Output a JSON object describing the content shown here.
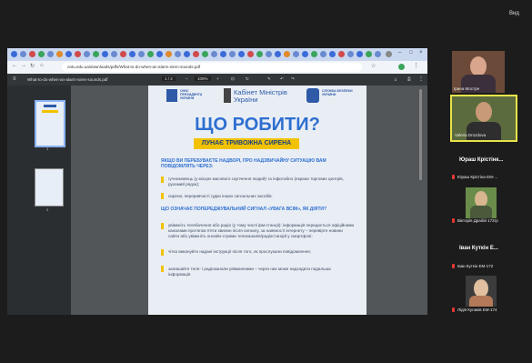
{
  "top_right_label": "Вид",
  "browser": {
    "url": "ontu.edu.ua/downloads/pdfs/What-to-do-when-an-alarm-siren-sounds.pdf"
  },
  "pdf_viewer": {
    "filename": "What-to-do-when-an-alarm-siren-sounds.pdf",
    "page_indicator": "1 / 2",
    "zoom": "100%",
    "thumb_numbers": [
      "1",
      "2"
    ]
  },
  "pdf_page": {
    "logos": [
      "ОФІС ПРЕЗИДЕНТА УКРАЇНИ",
      "Кабінет Міністрів України",
      "СЛУЖБА БЕЗПЕКИ УКРАЇНИ"
    ],
    "title": "ЩО РОБИТИ?",
    "subtitle": "ЛУНАЄ ТРИВОЖНА СИРЕНА",
    "q1": "ЯКЩО ВИ ПЕРЕБУВАЄТЕ НАДВОРІ, ПРО НАДЗВИЧАЙНУ СИТУАЦІЮ ВАМ ПОВІДОМЛЯТЬ ЧЕРЕЗ:",
    "b1": "гучномовець (у місцях масового скупчення людей) та інфотабло (екрани торгових центрів, рухомий рядок);",
    "b2": "сирени, переривчасті гудки інших сигнальних засобів.",
    "q2": "ЩО ОЗНАЧАЄ ПОПЕРЕДЖУВАЛЬНИЙ СИГНАЛ «УВАГА ВСІМ», ЯК ДІЯТИ?",
    "b3": "увімкніть телебачення або радіо (у тому числі фм-станції): інформація передається офіційними каналами протягом п'яти хвилин після сигналу, за наявності інтернету – перевірте новини сайти або увімкніть онлайн-стрими телеканалів/радіостанцій у смартфоні;",
    "b4": "чітко виконуйте надані інструкції після того, як прослухали повідомлення;",
    "b5": "залишайте теле- і радіоканали увімкненими – через них може надходити подальша інформація."
  },
  "participants": [
    {
      "name": "Ірина Мостре"
    },
    {
      "name": "Valeria Drozdova"
    },
    {
      "big": "Юраш Крістінк...",
      "name": "Юраш Крістіна ЕМ-..."
    },
    {
      "name": "Вікторія Драбій 172гр"
    },
    {
      "big": "Іван Куткін Е...",
      "name": "Іван Куткін ЕМ-172"
    },
    {
      "name": "Лідія Кулаків ЕМ-174"
    }
  ]
}
